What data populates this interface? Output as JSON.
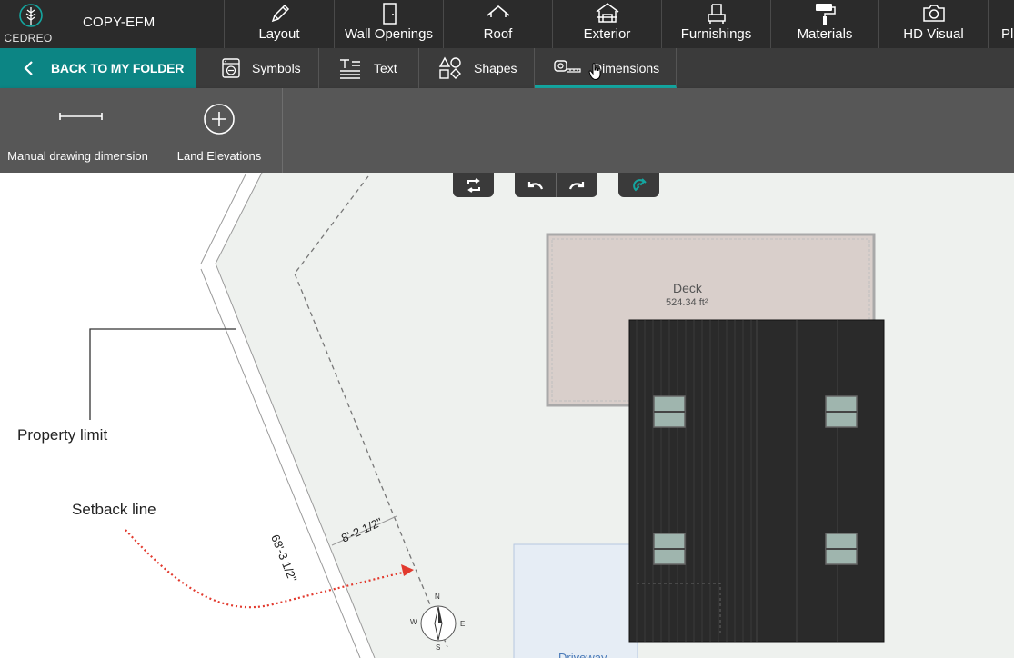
{
  "app": {
    "brand": "CEDREO",
    "project_name": "COPY-EFM"
  },
  "main_tabs": [
    {
      "label": "Layout",
      "icon": "pencil-icon"
    },
    {
      "label": "Wall Openings",
      "icon": "door-icon"
    },
    {
      "label": "Roof",
      "icon": "roof-icon"
    },
    {
      "label": "Exterior",
      "icon": "house-exterior-icon"
    },
    {
      "label": "Furnishings",
      "icon": "armchair-icon"
    },
    {
      "label": "Materials",
      "icon": "paint-roller-icon"
    },
    {
      "label": "HD Visual",
      "icon": "camera-icon"
    },
    {
      "label": "Pl",
      "icon": ""
    }
  ],
  "subbar": {
    "back_label": "BACK TO MY FOLDER",
    "tabs": [
      {
        "label": "Symbols",
        "icon": "symbols-icon"
      },
      {
        "label": "Text",
        "icon": "text-icon"
      },
      {
        "label": "Shapes",
        "icon": "shapes-icon"
      },
      {
        "label": "Dimensions",
        "icon": "tape-measure-icon",
        "active": true
      }
    ]
  },
  "tools": [
    {
      "label": "Manual drawing dimension",
      "icon": "dimension-line-icon"
    },
    {
      "label": "Land Elevations",
      "icon": "plus-circle-icon"
    }
  ],
  "floating_buttons": [
    "swap-icon",
    "undo-icon",
    "redo-icon",
    "magnet-icon"
  ],
  "plan": {
    "deck_label": "Deck",
    "deck_area": "524.34 ft²",
    "property_limit_label": "Property limit",
    "setback_label": "Setback line",
    "dimension_long": "68'-3 1/2\"",
    "dimension_short": "8'-2 1/2\"",
    "compass": {
      "n": "N",
      "e": "E",
      "s": "S",
      "w": "W"
    },
    "driveway_label": "Driveway"
  },
  "colors": {
    "topbar": "#2b2b2b",
    "subbar": "#3b3b3b",
    "toolpanel": "#575757",
    "accent": "#0c8584",
    "active_underline": "#14a6a0",
    "lot_fill": "#eef1ee",
    "deck_fill": "#d9cfcb",
    "roof_fill": "#2a2a2a",
    "driveway_fill": "#e6edf5",
    "annotation_red": "#e23a2e"
  }
}
